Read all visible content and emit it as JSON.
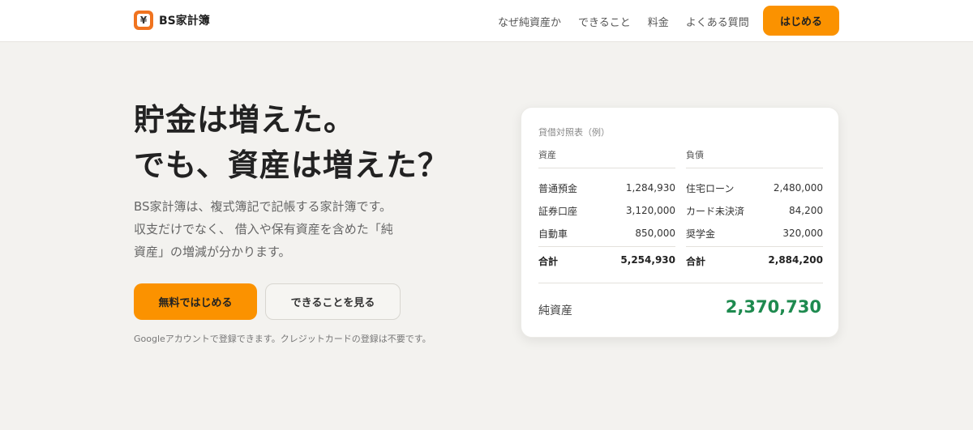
{
  "header": {
    "brand": "BS家計簿",
    "nav": [
      "なぜ純資産か",
      "できること",
      "料金",
      "よくある質問"
    ],
    "cta": "はじめる"
  },
  "hero": {
    "headline_line1": "貯金は増えた。",
    "headline_line2": "でも、資産は増えた？",
    "description_line1": "BS家計簿は、複式簿記で記帳する家計簿です。",
    "description_line2": "収支だけでなく、 借入や保有資産を含めた「純",
    "description_line3": "資産」の増減が分かります。",
    "primary_button": "無料ではじめる",
    "secondary_button": "できることを見る",
    "note": "Googleアカウントで登録できます。クレジットカードの登録は不要です。"
  },
  "card": {
    "title": "貸借対照表（例）",
    "assets": {
      "heading": "資産",
      "items": [
        {
          "label": "普通預金",
          "value": "1,284,930"
        },
        {
          "label": "証券口座",
          "value": "3,120,000"
        },
        {
          "label": "自動車",
          "value": "850,000"
        }
      ],
      "total_label": "合計",
      "total_value": "5,254,930"
    },
    "liabilities": {
      "heading": "負債",
      "items": [
        {
          "label": "住宅ローン",
          "value": "2,480,000"
        },
        {
          "label": "カード未決済",
          "value": "84,200"
        },
        {
          "label": "奨学金",
          "value": "320,000"
        }
      ],
      "total_label": "合計",
      "total_value": "2,884,200"
    },
    "net_label": "純資産",
    "net_value": "2,370,730"
  },
  "colors": {
    "accent": "#fb9200",
    "positive": "#1e8a4f",
    "background": "#f3f2ef"
  }
}
